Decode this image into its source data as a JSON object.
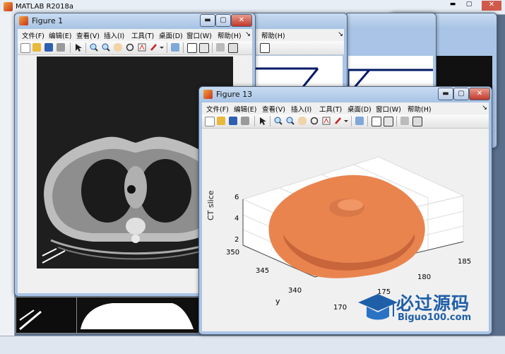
{
  "app": {
    "title": "MATLAB R2018a"
  },
  "figure1": {
    "title": "Figure 1",
    "menu": [
      "文件(F)",
      "编辑(E)",
      "查看(V)",
      "插入(I)",
      "工具(T)",
      "桌面(D)",
      "窗口(W)",
      "帮助(H)"
    ]
  },
  "background_windows": {
    "help_label": "帮助(H)"
  },
  "figure13": {
    "title": "Figure 13",
    "menu": [
      "文件(F)",
      "编辑(E)",
      "查看(V)",
      "插入(I)",
      "工具(T)",
      "桌面(D)",
      "窗口(W)",
      "帮助(H)"
    ],
    "plot": {
      "z_label": "CT slice",
      "y_label": "y",
      "z_ticks": [
        "2",
        "4",
        "6"
      ],
      "y_ticks": [
        "340",
        "345",
        "350"
      ],
      "x_ticks": [
        "170",
        "175",
        "180",
        "185"
      ],
      "surface_color": "#e9844f"
    }
  },
  "watermark": {
    "brand": "必过源码",
    "url": "Biguo100.com"
  },
  "window_controls": {
    "minimize": "▬",
    "maximize": "▢",
    "close": "✕",
    "menu_arrow": "↘"
  }
}
